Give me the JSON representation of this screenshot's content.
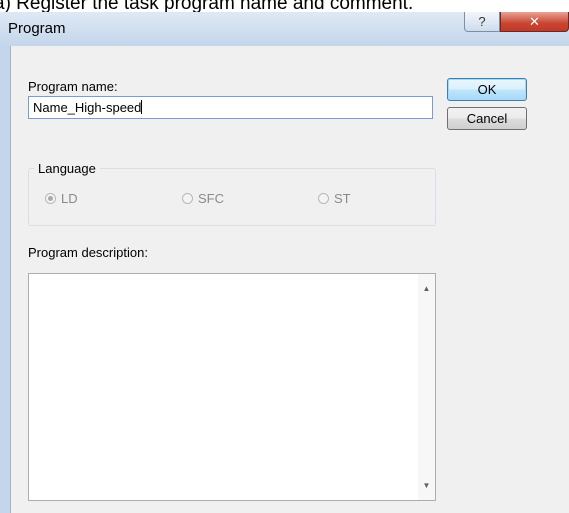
{
  "caption": "a) Register the task program name and comment.",
  "window": {
    "title": "Program",
    "help_glyph": "?",
    "close_glyph": "✕"
  },
  "form": {
    "program_name_label": "Program name:",
    "program_name_value": "Name_High-speed",
    "language_label": "Language",
    "languages": [
      {
        "label": "LD",
        "selected": true
      },
      {
        "label": "SFC",
        "selected": false
      },
      {
        "label": "ST",
        "selected": false
      }
    ],
    "description_label": "Program description:",
    "description_value": ""
  },
  "buttons": {
    "ok": "OK",
    "cancel": "Cancel"
  },
  "scroll": {
    "up": "▲",
    "down": "▼"
  },
  "colors": {
    "window_frame": "#c4d6eb",
    "close_button": "#c8452f",
    "dialog_bg": "#f0f0f0"
  }
}
